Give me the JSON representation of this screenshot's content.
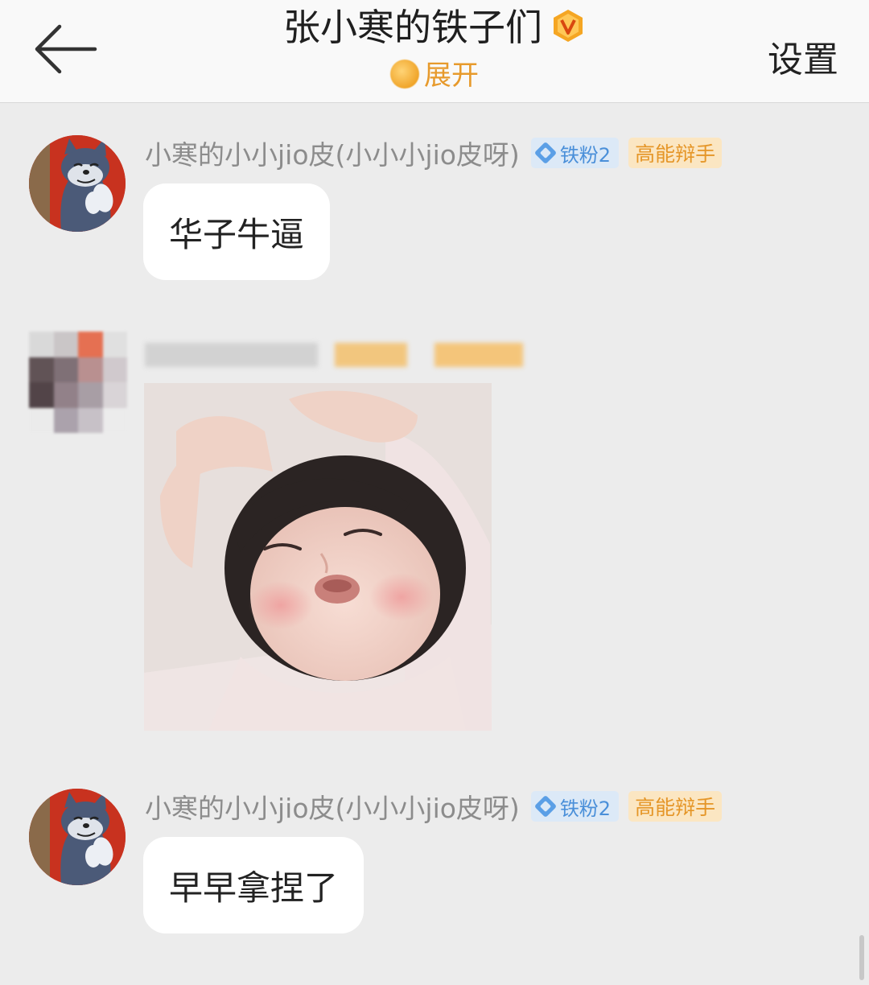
{
  "header": {
    "title": "张小寒的铁子们",
    "verified_icon": "v-badge-icon",
    "subtitle": "展开",
    "settings_label": "设置",
    "back_icon": "arrow-left-icon"
  },
  "messages": [
    {
      "user": "小寒的小小jio皮(小小小jio皮呀)",
      "fan_badge": "铁粉2",
      "title_badge": "高能辩手",
      "text": "华子牛逼",
      "avatar": "tom-cat-avatar"
    },
    {
      "user": "",
      "image": "baby-photo-sticker",
      "avatar": "blurred-avatar"
    },
    {
      "user": "小寒的小小jio皮(小小小jio皮呀)",
      "fan_badge": "铁粉2",
      "title_badge": "高能辩手",
      "text": "早早拿捏了",
      "avatar": "tom-cat-avatar"
    }
  ],
  "colors": {
    "background": "#ececec",
    "header_bg": "#f9f9f9",
    "accent_orange": "#e79a2c",
    "fan_blue": "#4a8fd9"
  }
}
